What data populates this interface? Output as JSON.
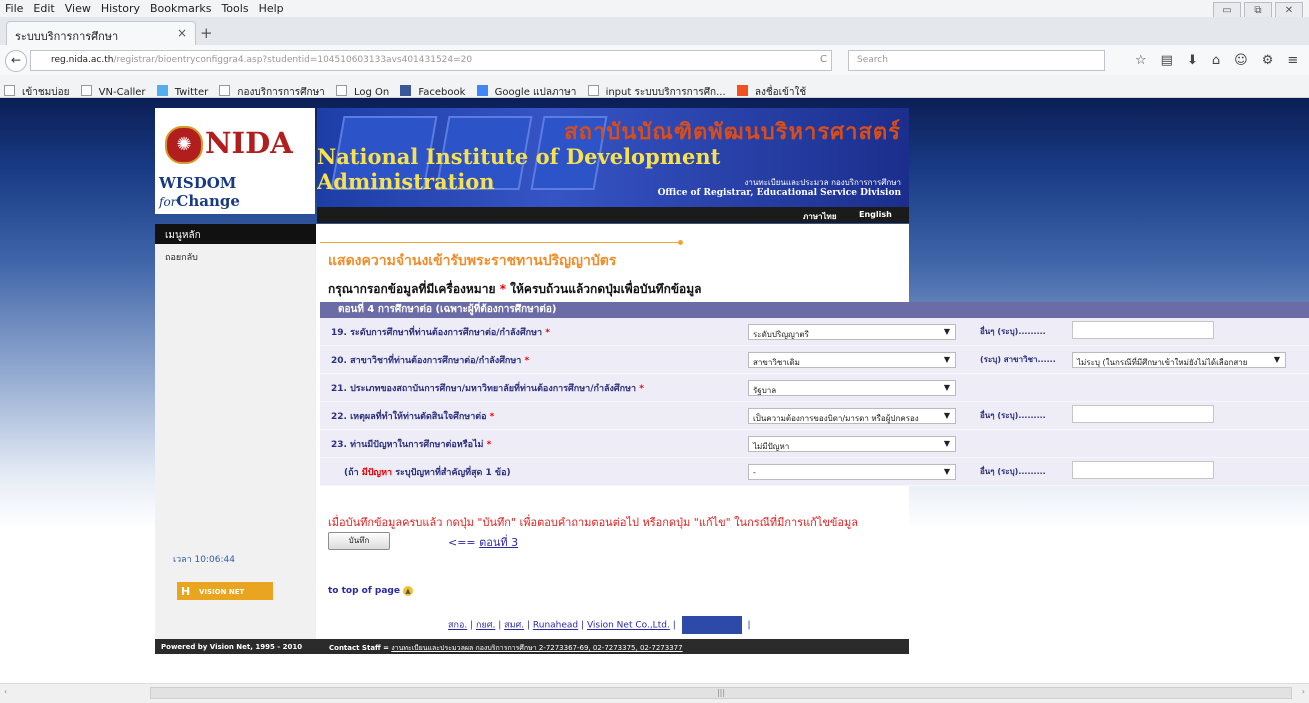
{
  "menu": [
    "File",
    "Edit",
    "View",
    "History",
    "Bookmarks",
    "Tools",
    "Help"
  ],
  "window_controls": [
    "▭",
    "⧉",
    "✕"
  ],
  "tab": {
    "title": "ระบบบริการการศึกษา",
    "close": "×",
    "new": "+"
  },
  "nav": {
    "back": "←",
    "url_host": "reg.nida.ac.th",
    "url_rest": "/registrar/bioentryconfiggra4.asp?studentid=104510603133avs401431524=20",
    "reload": "C",
    "search_placeholder": "Search"
  },
  "toolbar_icons": [
    "☆",
    "▤",
    "⬇",
    "⌂",
    "☺",
    "⚙",
    "≡"
  ],
  "bookmarks": [
    "เข้าชมบ่อย",
    "VN-Caller",
    "Twitter",
    "กองบริการการศึกษา",
    "Log On",
    "Facebook",
    "Google แปลภาษา",
    "input ระบบบริการการศึก...",
    "ลงชื่อเข้าใช้"
  ],
  "header": {
    "logo_text": "NIDA",
    "slogan_main": "WISDOM",
    "slogan_italic": "for",
    "slogan_end": "Change",
    "thai_name": "สถาบันบัณฑิตพัฒนบริหารศาสตร์",
    "english_name": "National Institute of Development Administration",
    "sub_thai": "งานทะเบียนและประมวล กองบริการการศึกษา",
    "sub_english": "Office of Registrar, Educational Service Division",
    "lang_thai": "ภาษาไทย",
    "lang_english": "English"
  },
  "sidebar": {
    "title": "เมนูหลัก",
    "items": [
      "ถอยกลับ"
    ],
    "clock": "เวลา 10:06:44",
    "logo_text": "VISION NET"
  },
  "main": {
    "page_title": "แสดงความจำนงเข้ารับพระราชทานปริญญาบัตร",
    "instruction_pre": "กรุณากรอกข้อมูลที่มีเครื่องหมาย",
    "instruction_star": "*",
    "instruction_post": "ให้ครบถ้วนแล้วกดปุ่มเพื่อบันทึกข้อมูล",
    "section_title": "ตอนที่ 4 การศึกษาต่อ (เฉพาะผู้ที่ต้องการศึกษาต่อ)",
    "questions": [
      {
        "label": "19. ระดับการศึกษาที่ท่านต้องการศึกษาต่อ/กำลังศึกษา",
        "required": "*",
        "select": "ระดับปริญญาตรี",
        "other_label": "อื่นๆ (ระบุ).........",
        "type": "text"
      },
      {
        "label": "20. สาขาวิชาที่ท่านต้องการศึกษาต่อ/กำลังศึกษา",
        "required": "*",
        "select": "สาขาวิชาเดิม",
        "other_label": "(ระบุ) สาขาวิชา......",
        "type": "select",
        "other_select": "ไม่ระบุ (ในกรณีที่มีศึกษาเข้าใหม่ยังไม่ได้เลือกสาย"
      },
      {
        "label": "21. ประเภทของสถาบันการศึกษา/มหาวิทยาลัยที่ท่านต้องการศึกษา/กำลังศึกษา",
        "required": "*",
        "select": "รัฐบาล",
        "other_label": "",
        "type": "none"
      },
      {
        "label": "22. เหตุผลที่ทำให้ท่านตัดสินใจศึกษาต่อ",
        "required": "*",
        "select": "เป็นความต้องการของบิดา/มารดา หรือผู้ปกครอง",
        "other_label": "อื่นๆ (ระบุ).........",
        "type": "text"
      },
      {
        "label": "23. ท่านมีปัญหาในการศึกษาต่อหรือไม่",
        "required": "*",
        "select": "ไม่มีปัญหา",
        "other_label": "",
        "type": "none"
      },
      {
        "label": "(ถ้า",
        "label_red": "มีปัญหา",
        "label_end": "ระบุปัญหาที่สำคัญที่สุด 1 ข้อ)",
        "required": "",
        "select": "-",
        "other_label": "อื่นๆ (ระบุ).........",
        "type": "text"
      }
    ],
    "notice": "เมื่อบันทึกข้อมูลครบแล้ว กดปุ่ม \"บันทึก\" เพื่อตอบคำถามตอนต่อไป หรือกดปุ่ม \"แก้ไข\" ในกรณีที่มีการแก้ไขข้อมูล",
    "save_label": "บันทึก",
    "back_arrow": "<==",
    "back_link": "ตอนที่ 3",
    "to_top": "to top of page",
    "to_top_icon": "▲",
    "footer_links": [
      "สกอ.",
      "กยศ.",
      "สมศ.",
      "Runahead",
      "Vision Net Co.,Ltd."
    ],
    "footer_sep": "|"
  },
  "footer": {
    "powered": "Powered by Vision Net, 1995 - 2010",
    "contact_label": "Contact Staff =",
    "contact_link": "งานทะเบียนและประมวลผล กองบริการการศึกษา 2-7273367-69, 02-7273375, 02-7273377"
  },
  "scrollbar": {
    "left": "‹",
    "right": "›",
    "grip": "|||"
  }
}
